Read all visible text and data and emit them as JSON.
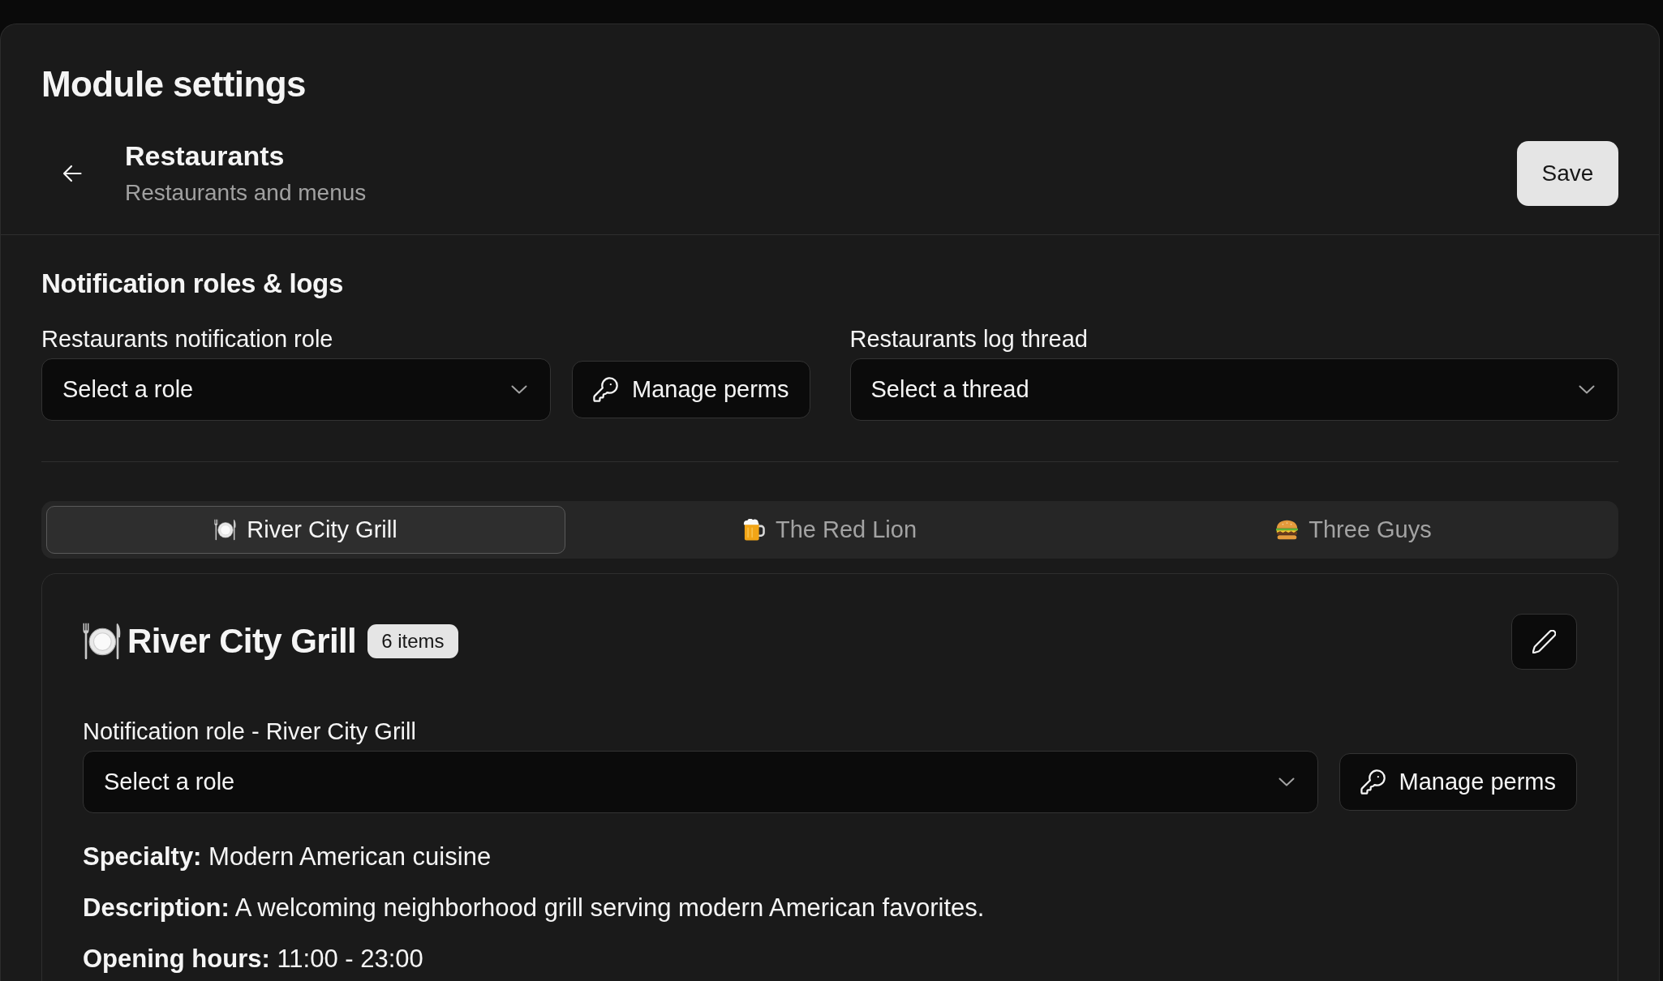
{
  "page": {
    "title": "Module settings"
  },
  "module": {
    "name": "Restaurants",
    "description": "Restaurants and menus"
  },
  "save_button": "Save",
  "notification_roles": {
    "title": "Notification roles & logs",
    "role_select": {
      "label": "Restaurants notification role",
      "placeholder": "Select a role"
    },
    "manage_perms_button": "Manage perms",
    "log_thread_select": {
      "label": "Restaurants log thread",
      "placeholder": "Select a thread"
    }
  },
  "tabs": [
    {
      "kind": "plate",
      "label": "River City Grill",
      "selected": true
    },
    {
      "kind": "beer",
      "label": "The Red Lion",
      "selected": false
    },
    {
      "kind": "burger",
      "label": "Three Guys",
      "selected": false
    }
  ],
  "restaurant_card": {
    "kind": "plate",
    "name": "River City Grill",
    "item_count": "6 items",
    "role_select": {
      "label": "Notification role - River City Grill",
      "placeholder": "Select a role"
    },
    "manage_perms_button": "Manage perms",
    "details": [
      "**Specialty:** Modern American cuisine",
      "**Description:** A welcoming neighborhood grill serving modern American favorites.",
      "**Opening hours:** 11:00 - 23:00"
    ]
  }
}
